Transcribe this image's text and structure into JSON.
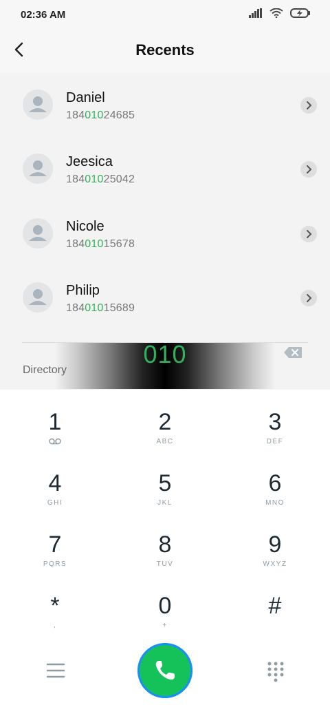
{
  "status_bar": {
    "time": "02:36 AM"
  },
  "header": {
    "title": "Recents"
  },
  "contacts": [
    {
      "name": "Daniel",
      "number_prefix": "184",
      "number_match": "010",
      "number_suffix": "24685"
    },
    {
      "name": "Jeesica",
      "number_prefix": "184",
      "number_match": "010",
      "number_suffix": "25042"
    },
    {
      "name": "Nicole",
      "number_prefix": "184",
      "number_match": "010",
      "number_suffix": "15678"
    },
    {
      "name": "Philip",
      "number_prefix": "184",
      "number_match": "010",
      "number_suffix": "15689"
    }
  ],
  "dialer": {
    "input": "010",
    "directory_label": "Directory"
  },
  "keypad": [
    {
      "digit": "1",
      "sub": ""
    },
    {
      "digit": "2",
      "sub": "ABC"
    },
    {
      "digit": "3",
      "sub": "DEF"
    },
    {
      "digit": "4",
      "sub": "GHI"
    },
    {
      "digit": "5",
      "sub": "JKL"
    },
    {
      "digit": "6",
      "sub": "MNO"
    },
    {
      "digit": "7",
      "sub": "PQRS"
    },
    {
      "digit": "8",
      "sub": "TUV"
    },
    {
      "digit": "9",
      "sub": "WXYZ"
    },
    {
      "digit": "*",
      "sub": ","
    },
    {
      "digit": "0",
      "sub": "+"
    },
    {
      "digit": "#",
      "sub": ""
    }
  ],
  "icons": {
    "voicemail": "voicemail-icon",
    "call": "phone-icon",
    "menu": "menu-icon",
    "dialpad": "dialpad-icon"
  },
  "colors": {
    "match": "#31b25a",
    "call_button": "#15c25a",
    "call_ring": "#1a8cff"
  }
}
